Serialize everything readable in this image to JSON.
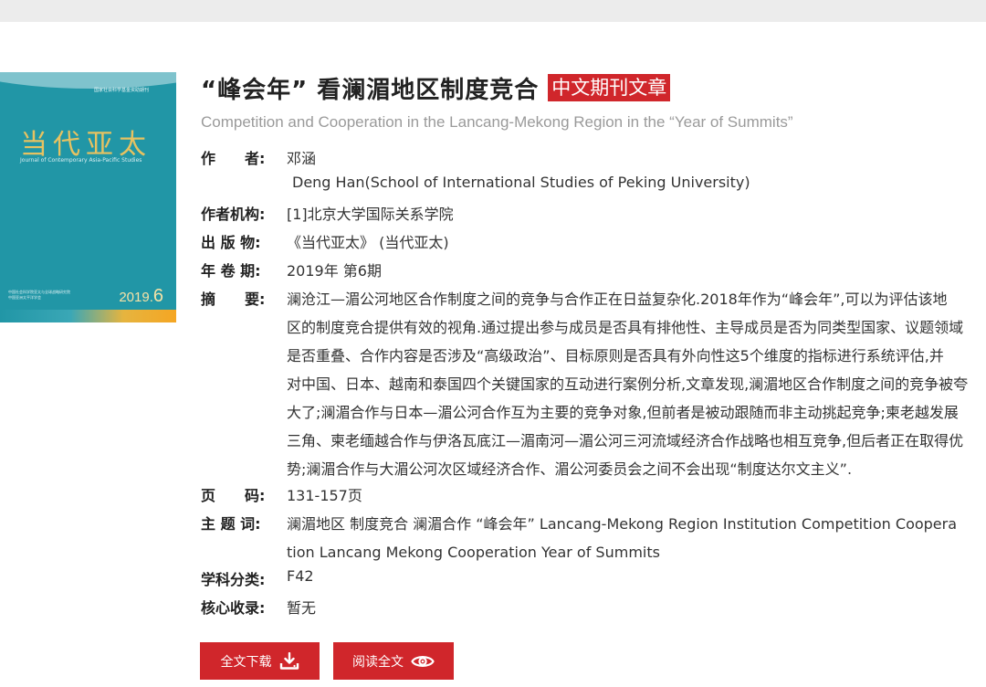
{
  "cover": {
    "small_title": "国家社会科学基金资助期刊",
    "title": "当代亚太",
    "english_name": "Journal of Contemporary Asia-Pacific Studies",
    "publisher_lines": [
      "中国社会科学院亚太与全球战略研究院",
      "中国亚洲太平洋学会"
    ],
    "issue_year": "2019.",
    "issue_number": "6"
  },
  "article": {
    "title": "“峰会年” 看澜湄地区制度竞合",
    "badge": "中文期刊文章",
    "english_title": "Competition and Cooperation in the Lancang-Mekong Region in the “Year of Summits”"
  },
  "fields": {
    "author_label": "作　　者:",
    "author_cn": "邓涵",
    "author_en": "Deng Han(School of International Studies of Peking University)",
    "institution_label": "作者机构:",
    "institution": "[1]北京大学国际关系学院",
    "publication_label": "出 版 物:",
    "publication": "《当代亚太》 (当代亚太)",
    "year_issue_label": "年 卷 期:",
    "year_issue": "2019年 第6期",
    "abstract_label": "摘　　要:",
    "abstract_lines": [
      "澜沧江—湄公河地区合作制度之间的竞争与合作正在日益复杂化.2018年作为“峰会年”,可以为评估该地",
      "区的制度竞合提供有效的视角.通过提出参与成员是否具有排他性、主导成员是否为同类型国家、议题领域",
      "是否重叠、合作内容是否涉及“高级政治”、目标原则是否具有外向性这5个维度的指标进行系统评估,并",
      "对中国、日本、越南和泰国四个关键国家的互动进行案例分析,文章发现,澜湄地区合作制度之间的竞争被夸",
      "大了;澜湄合作与日本—湄公河合作互为主要的竞争对象,但前者是被动跟随而非主动挑起竞争;柬老越发展",
      "三角、柬老缅越合作与伊洛瓦底江—湄南河—湄公河三河流域经济合作战略也相互竞争,但后者正在取得优",
      "势;澜湄合作与大湄公河次区域经济合作、湄公河委员会之间不会出现“制度达尔文主义”."
    ],
    "pages_label": "页　　码:",
    "pages": "131-157页",
    "keywords_label": "主 题 词:",
    "keywords_lines": [
      "澜湄地区 制度竞合 澜湄合作 “峰会年”   Lancang-Mekong Region Institution Competition Coopera",
      "tion Lancang Mekong Cooperation Year of Summits"
    ],
    "discipline_label": "学科分类:",
    "discipline": "F42",
    "core_label": "核心收录:",
    "core": "暂无"
  },
  "buttons": {
    "download_label": "全文下载",
    "read_label": "阅读全文"
  },
  "colors": {
    "accent_red": "#d0262b",
    "cover_teal": "#2196a6",
    "cover_gold": "#e6c261",
    "subtitle_gray": "#9a9a9a"
  },
  "icons": {
    "download": "download-icon",
    "read": "eye-icon"
  }
}
